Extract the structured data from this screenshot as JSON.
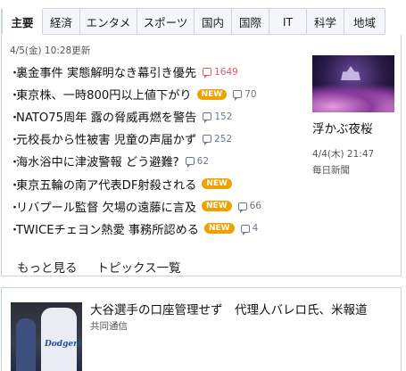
{
  "tabs": [
    {
      "label": "主要",
      "active": true
    },
    {
      "label": "経済"
    },
    {
      "label": "エンタメ"
    },
    {
      "label": "スポーツ"
    },
    {
      "label": "国内"
    },
    {
      "label": "国際"
    },
    {
      "label": "IT"
    },
    {
      "label": "科学"
    },
    {
      "label": "地域"
    }
  ],
  "updated": "4/5(金) 10:28更新",
  "headlines": [
    {
      "bullet": "・",
      "text": "裏金事件 実態解明なき幕引き優先",
      "comments": "1649",
      "hot": true
    },
    {
      "bullet": "・",
      "text": "東京株、一時800円以上値下がり",
      "new": "NEW",
      "comments": "70"
    },
    {
      "bullet": "・",
      "text": "NATO75周年 露の脅威再燃を警告",
      "comments": "152"
    },
    {
      "bullet": "・",
      "text": "元校長から性被害 児童の声届かず",
      "comments": "252"
    },
    {
      "bullet": "・",
      "text": "海水浴中に津波警報 どう避難?",
      "comments": "62"
    },
    {
      "bullet": "・",
      "text": "東京五輪の南ア代表DF射殺される",
      "new": "NEW"
    },
    {
      "bullet": "・",
      "text": "リバプール監督 欠場の遠藤に言及",
      "new": "NEW",
      "comments": "66"
    },
    {
      "bullet": "・",
      "text": "TWICEチェヨン熱愛 事務所認める",
      "new": "NEW",
      "comments": "4"
    }
  ],
  "links": {
    "more": "もっと見る",
    "topics": "トピックス一覧"
  },
  "feature": {
    "title": "浮かぶ夜桜",
    "time": "4/4(木) 21:47",
    "source": "毎日新聞"
  },
  "article": {
    "title": "大谷選手の口座管理せず　代理人バレロ氏、米報道",
    "source": "共同通信",
    "thumb_text": "Dodgers"
  },
  "colors": {
    "new_badge": "#f0a100",
    "hot_comments": "#e05a6a",
    "border": "#c8d3e3"
  }
}
